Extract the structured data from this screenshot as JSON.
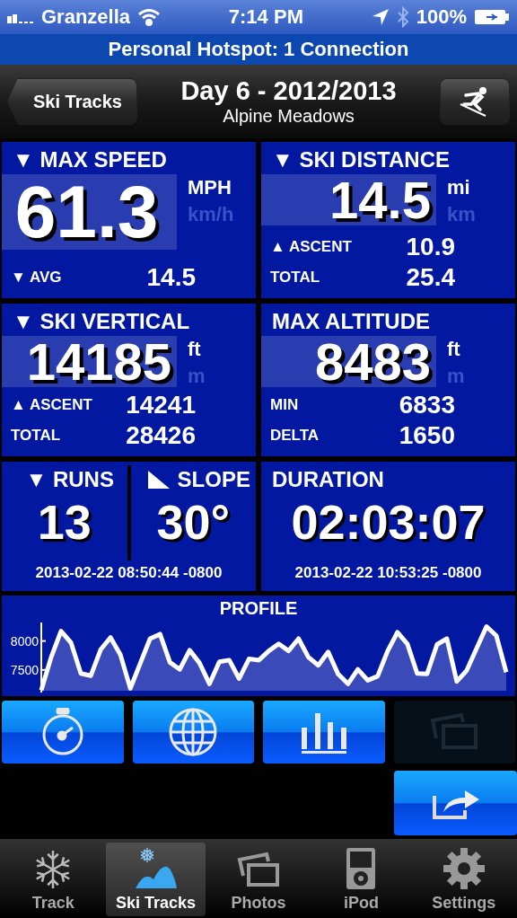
{
  "status_bar": {
    "carrier": "Granzella",
    "time": "7:14 PM",
    "battery": "100%"
  },
  "hotspot_banner": "Personal Hotspot: 1 Connection",
  "nav": {
    "back": "Ski Tracks",
    "title": "Day 6 - 2012/2013",
    "subtitle": "Alpine Meadows"
  },
  "stats": [
    {
      "title": "▼ MAX SPEED",
      "value": "61.3",
      "kind": "hero",
      "units": [
        {
          "label": "MPH",
          "selected": true
        },
        {
          "label": "km/h",
          "selected": false
        }
      ],
      "rows": [
        {
          "label": "▼ AVG",
          "value": "14.5"
        }
      ]
    },
    {
      "title": "▼ SKI DISTANCE",
      "value": "14.5",
      "kind": "standard",
      "units": [
        {
          "label": "mi",
          "selected": true
        },
        {
          "label": "km",
          "selected": false
        }
      ],
      "rows": [
        {
          "label": "▲ ASCENT",
          "value": "10.9"
        },
        {
          "label": "TOTAL",
          "value": "25.4"
        }
      ]
    },
    {
      "title": "▼ SKI VERTICAL",
      "value": "14185",
      "kind": "standard",
      "units": [
        {
          "label": "ft",
          "selected": true
        },
        {
          "label": "m",
          "selected": false
        }
      ],
      "rows": [
        {
          "label": "▲ ASCENT",
          "value": "14241"
        },
        {
          "label": "TOTAL",
          "value": "28426"
        }
      ]
    },
    {
      "title": "MAX ALTITUDE",
      "value": "8483",
      "kind": "standard",
      "units": [
        {
          "label": "ft",
          "selected": true
        },
        {
          "label": "m",
          "selected": false
        }
      ],
      "rows": [
        {
          "label": "MIN",
          "value": "6833"
        },
        {
          "label": "DELTA",
          "value": "1650"
        }
      ]
    }
  ],
  "runs": {
    "title": "▼ RUNS",
    "value": "13",
    "time": "2013-02-22 08:50:44 -0800"
  },
  "slope": {
    "title": "SLOPE",
    "value": "30°"
  },
  "duration": {
    "title": "DURATION",
    "value": "02:03:07",
    "time": "2013-02-22 10:53:25 -0800"
  },
  "profile": {
    "title": "PROFILE",
    "chart_data": {
      "type": "area",
      "yticks": [
        7500,
        8000
      ],
      "ylim": [
        7140,
        8320
      ],
      "categories": [
        null,
        null,
        null,
        null,
        null,
        null,
        null,
        null,
        null,
        null,
        null,
        null,
        null,
        null,
        null,
        null,
        null,
        null,
        null,
        null,
        null,
        null,
        null,
        null,
        null,
        null,
        null,
        null,
        null,
        null,
        null,
        null,
        null,
        null,
        null,
        null,
        null,
        null,
        null,
        null,
        null,
        null,
        null,
        null,
        null,
        null,
        null,
        null
      ],
      "series": [
        {
          "color": "#ffffff",
          "values": [
            7150,
            7720,
            8170,
            7970,
            7440,
            7400,
            7850,
            8060,
            7760,
            7180,
            7610,
            8040,
            8120,
            7630,
            7510,
            7840,
            7620,
            7260,
            7640,
            7670,
            7350,
            7690,
            7670,
            7830,
            7950,
            7830,
            8040,
            7720,
            7580,
            7810,
            7430,
            7260,
            7510,
            7320,
            7390,
            7820,
            8150,
            7950,
            7440,
            7430,
            7940,
            8040,
            7300,
            7490,
            7870,
            8250,
            8090,
            7460
          ]
        }
      ]
    }
  },
  "action_buttons": [
    {
      "kind": "stopwatch",
      "disabled": false
    },
    {
      "kind": "globe",
      "disabled": false
    },
    {
      "kind": "chart",
      "disabled": false
    },
    {
      "kind": "photos",
      "disabled": true
    }
  ],
  "share_button": {
    "kind": "share",
    "disabled": false
  },
  "tabs": [
    {
      "label": "Track",
      "kind": "snowflake",
      "selected": false
    },
    {
      "label": "Ski Tracks",
      "kind": "mountain",
      "selected": true
    },
    {
      "label": "Photos",
      "kind": "photos",
      "selected": false
    },
    {
      "label": "iPod",
      "kind": "ipod",
      "selected": false
    },
    {
      "label": "Settings",
      "kind": "gear",
      "selected": false
    }
  ]
}
